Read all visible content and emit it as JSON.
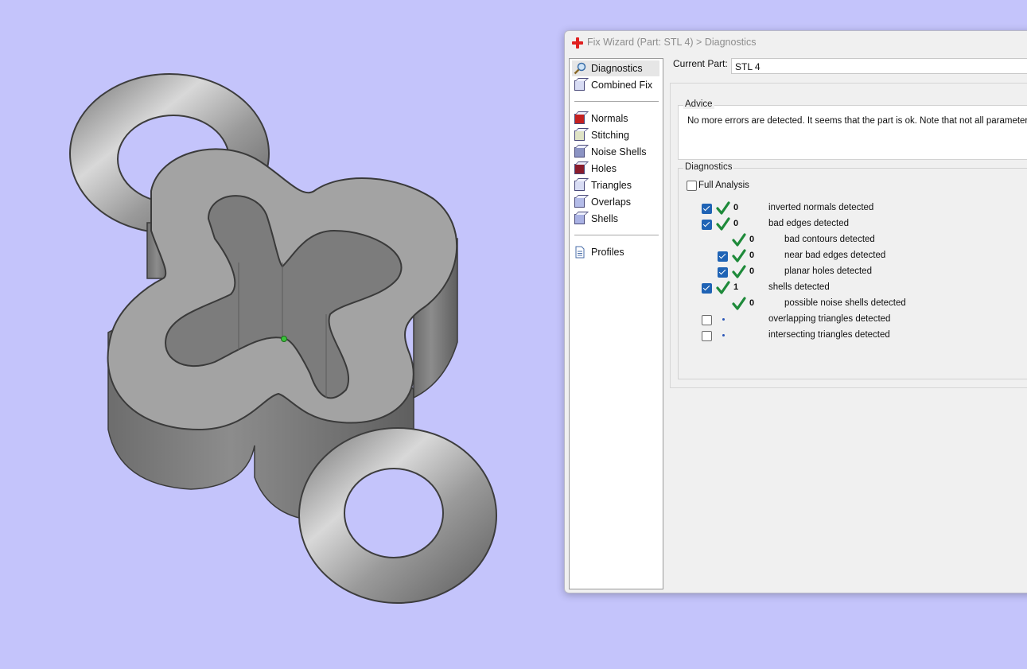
{
  "window": {
    "title": "Fix Wizard (Part: STL 4) > Diagnostics"
  },
  "nav": {
    "items": [
      {
        "label": "Diagnostics",
        "icon": "magnifier-icon",
        "selected": true
      },
      {
        "label": "Combined Fix",
        "icon": "cube-icon"
      },
      {
        "label": "Normals",
        "icon": "cube-red-face-icon"
      },
      {
        "label": "Stitching",
        "icon": "cube-stitch-icon"
      },
      {
        "label": "Noise Shells",
        "icon": "dotted-cube-icon"
      },
      {
        "label": "Holes",
        "icon": "cube-hole-icon"
      },
      {
        "label": "Triangles",
        "icon": "triangle-cube-icon"
      },
      {
        "label": "Overlaps",
        "icon": "overlap-cube-icon"
      },
      {
        "label": "Shells",
        "icon": "shell-cube-icon"
      },
      {
        "label": "Profiles",
        "icon": "document-icon"
      }
    ]
  },
  "part": {
    "label": "Current Part:",
    "value": "STL 4"
  },
  "advice": {
    "title": "Advice",
    "text": "No more errors are detected. It seems that the part is ok. Note that not all parameters w"
  },
  "diagnostics": {
    "title": "Diagnostics",
    "full_analysis": {
      "label": "Full Analysis",
      "checked": false
    },
    "rows": [
      {
        "checkbox": true,
        "checked": true,
        "status": "ok",
        "count": "0",
        "label": "inverted normals detected",
        "indent": 0
      },
      {
        "checkbox": true,
        "checked": true,
        "status": "ok",
        "count": "0",
        "label": "bad edges detected",
        "indent": 0
      },
      {
        "checkbox": false,
        "checked": false,
        "status": "ok",
        "count": "0",
        "label": "bad contours detected",
        "indent": 1
      },
      {
        "checkbox": true,
        "checked": true,
        "status": "ok",
        "count": "0",
        "label": "near bad edges detected",
        "indent": 1
      },
      {
        "checkbox": true,
        "checked": true,
        "status": "ok",
        "count": "0",
        "label": "planar holes detected",
        "indent": 1
      },
      {
        "checkbox": true,
        "checked": true,
        "status": "ok",
        "count": "1",
        "label": "shells detected",
        "indent": 0
      },
      {
        "checkbox": false,
        "checked": false,
        "status": "ok",
        "count": "0",
        "label": "possible noise shells detected",
        "indent": 1
      },
      {
        "checkbox": true,
        "checked": false,
        "status": "pending",
        "count": "",
        "label": "overlapping triangles detected",
        "indent": 0
      },
      {
        "checkbox": true,
        "checked": false,
        "status": "pending",
        "count": "",
        "label": "intersecting triangles detected",
        "indent": 0
      }
    ]
  },
  "colors": {
    "viewport_bg": "#c4c4fb",
    "check_green": "#1e8a3a",
    "checkbox_blue": "#1f63b5",
    "model_gray": "#a3a3a3"
  }
}
